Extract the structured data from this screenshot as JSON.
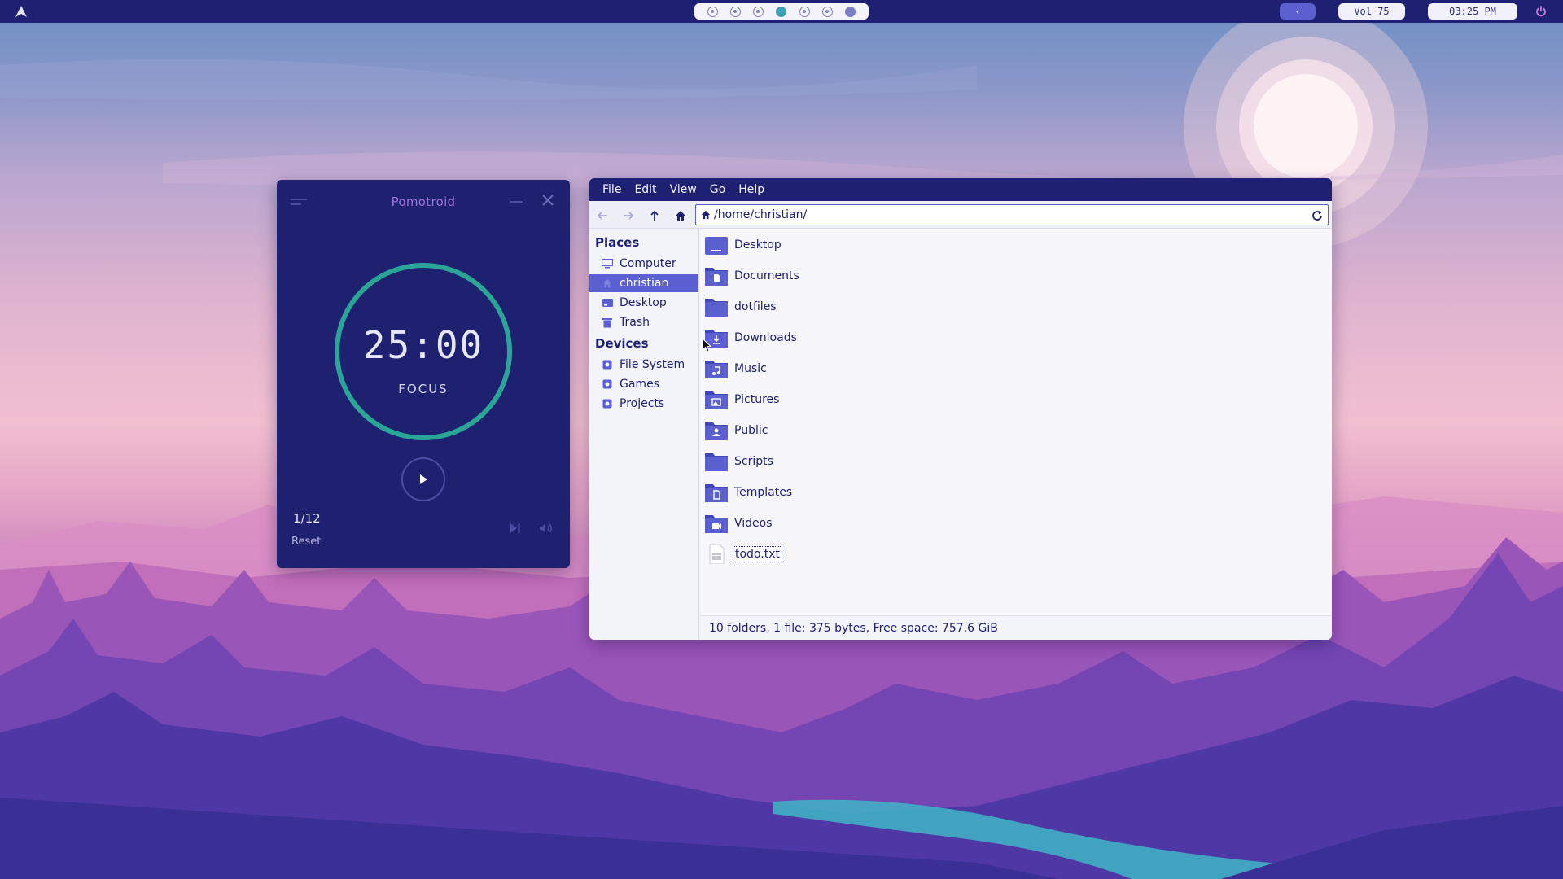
{
  "topbar": {
    "workspaces": [
      "ws1",
      "ws2",
      "ws3",
      "ws4",
      "ws5",
      "ws6",
      "ws7"
    ],
    "active_workspace": 4,
    "volume_label": "Vol 75",
    "clock": "03:25 PM",
    "back_icon": "chevron-left-icon",
    "power_icon": "power-icon"
  },
  "pomotroid": {
    "title": "Pomotroid",
    "timer": "25:00",
    "mode": "FOCUS",
    "round": "1/12",
    "reset_label": "Reset",
    "ring_color": "#2aa596",
    "title_color": "#a06fd8"
  },
  "file_manager": {
    "menu": [
      "File",
      "Edit",
      "View",
      "Go",
      "Help"
    ],
    "path": "/home/christian/",
    "sidebar": {
      "places_heading": "Places",
      "places": [
        "Computer",
        "christian",
        "Desktop",
        "Trash"
      ],
      "selected": "christian",
      "devices_heading": "Devices",
      "devices": [
        "File System",
        "Games",
        "Projects"
      ]
    },
    "files": [
      {
        "name": "Desktop",
        "kind": "folder-desktop"
      },
      {
        "name": "Documents",
        "kind": "folder-documents"
      },
      {
        "name": "dotfiles",
        "kind": "folder"
      },
      {
        "name": "Downloads",
        "kind": "folder-downloads"
      },
      {
        "name": "Music",
        "kind": "folder-music"
      },
      {
        "name": "Pictures",
        "kind": "folder-pictures"
      },
      {
        "name": "Public",
        "kind": "folder-public"
      },
      {
        "name": "Scripts",
        "kind": "folder"
      },
      {
        "name": "Templates",
        "kind": "folder-templates"
      },
      {
        "name": "Videos",
        "kind": "folder-videos"
      },
      {
        "name": "todo.txt",
        "kind": "text-file"
      }
    ],
    "status": "10 folders, 1 file: 375 bytes, Free space: 757.6 GiB"
  },
  "colors": {
    "bar": "#1e2172",
    "accent": "#5b5fd0",
    "folder": "#5b5fd0"
  }
}
